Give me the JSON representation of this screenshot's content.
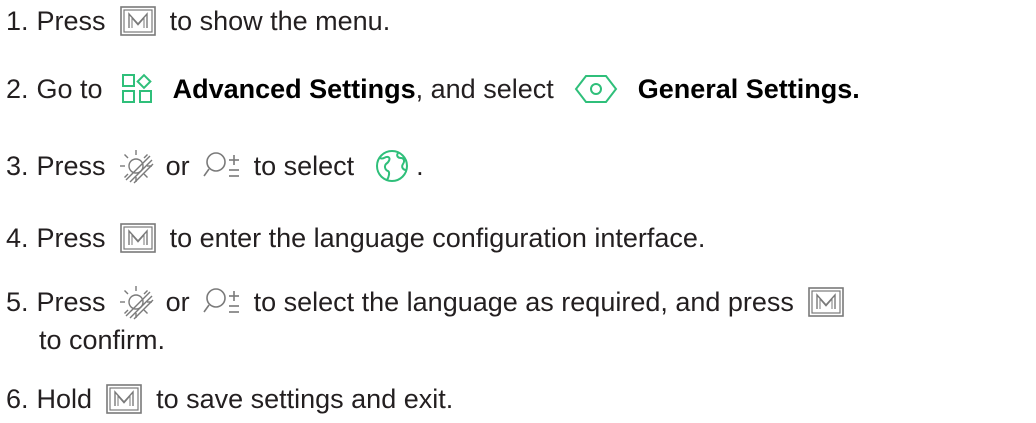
{
  "steps": [
    {
      "number": "1.",
      "t1": "Press",
      "t2": "to show the menu.",
      "icons": [
        "m-button-icon"
      ]
    },
    {
      "number": "2.",
      "t1": "Go to",
      "highlight1": "Advanced Settings",
      "t2": ", and select",
      "highlight2": "General Settings.",
      "icons": [
        "advanced-settings-icon",
        "general-settings-icon"
      ]
    },
    {
      "number": "3.",
      "t1": "Press",
      "t2": "or",
      "t3": "to select",
      "t4": ".",
      "icons": [
        "brightness-icon",
        "zoom-icon",
        "language-globe-icon"
      ]
    },
    {
      "number": "4.",
      "t1": "Press",
      "t2": "to enter the language configuration interface.",
      "icons": [
        "m-button-icon"
      ]
    },
    {
      "number": "5.",
      "t1": "Press",
      "t2": "or",
      "t3": "to select the language as required, and press",
      "t4": "to confirm.",
      "icons": [
        "brightness-icon",
        "zoom-icon",
        "m-button-icon"
      ]
    },
    {
      "number": "6.",
      "t1": "Hold",
      "t2": "to save settings and exit.",
      "icons": [
        "m-button-icon"
      ]
    }
  ],
  "colors": {
    "text": "#231f20",
    "icon_accent": "#2fbf7a",
    "m_key_stroke": "#7a7a7a"
  }
}
